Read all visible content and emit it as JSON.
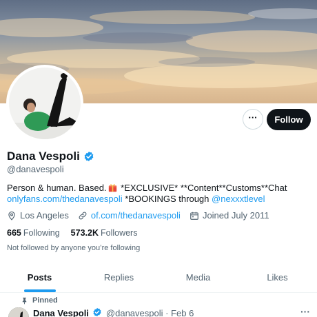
{
  "profile": {
    "name": "Dana Vespoli",
    "handle": "@danavespoli",
    "bio_text_1": "Person & human. Based.",
    "bio_text_2": " *EXCLUSIVE* **Content**Customs**Chat",
    "bio_link_1": "onlyfans.com/thedanavespoli",
    "bio_text_3": " *BOOKINGS through ",
    "bio_link_2": "@nexxxtlevel",
    "location": "Los Angeles",
    "website": "of.com/thedanavespoli",
    "joined": "Joined July 2011",
    "following_count": "665",
    "following_label": "Following",
    "followers_count": "573.2K",
    "followers_label": "Followers",
    "not_followed": "Not followed by anyone you’re following"
  },
  "actions": {
    "more_label": "···",
    "follow_label": "Follow"
  },
  "tabs": [
    {
      "label": "Posts"
    },
    {
      "label": "Replies"
    },
    {
      "label": "Media"
    },
    {
      "label": "Likes"
    }
  ],
  "pinned_tweet": {
    "pinned_label": "Pinned",
    "name": "Dana Vespoli",
    "meta": "@danavespoli · Feb 6",
    "more_label": "···"
  },
  "colors": {
    "accent": "#1d9bf0",
    "text": "#0f1419",
    "secondary": "#536471",
    "follow_bg": "#0f1419"
  },
  "icons": [
    "verified-badge-icon",
    "location-icon",
    "link-icon",
    "calendar-icon",
    "pin-icon",
    "more-icon"
  ]
}
